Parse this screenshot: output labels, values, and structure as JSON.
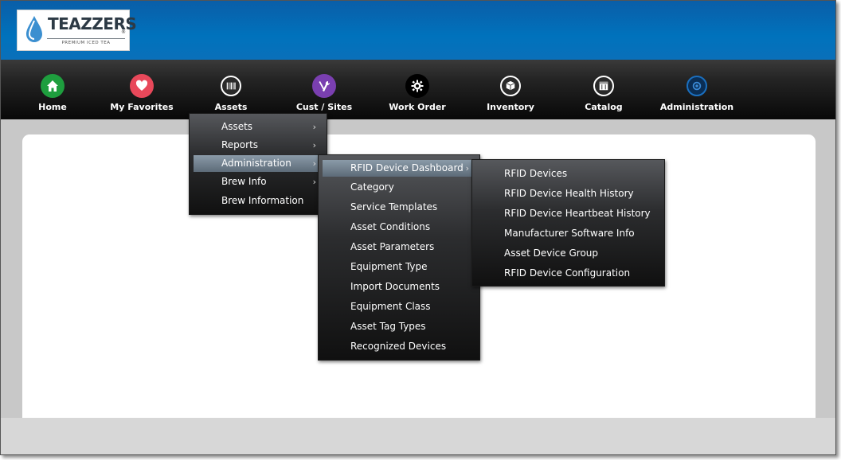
{
  "brand": {
    "name": "TEAZZERS",
    "tagline": "PREMIUM ICED TEA",
    "mark": "®"
  },
  "nav": [
    {
      "label": "Home",
      "icon": "home-icon",
      "color": "#1e9e3e"
    },
    {
      "label": "My Favorites",
      "icon": "heart-icon",
      "color": "#e8485a"
    },
    {
      "label": "Assets",
      "icon": "barcode-icon",
      "color": "#2a2a2a"
    },
    {
      "label": "Cust / Sites",
      "icon": "tools-icon",
      "color": "#7a3fb0"
    },
    {
      "label": "Work Order",
      "icon": "gear-icon",
      "color": "#000000"
    },
    {
      "label": "Inventory",
      "icon": "box-icon",
      "color": "#2a2a2a"
    },
    {
      "label": "Catalog",
      "icon": "catalog-icon",
      "color": "#2a2a2a"
    },
    {
      "label": "Administration",
      "icon": "target-icon",
      "color": "#0a2e55"
    }
  ],
  "menu1": [
    {
      "label": "Assets",
      "submenu": true
    },
    {
      "label": "Reports",
      "submenu": true
    },
    {
      "label": "Administration",
      "submenu": true,
      "active": true
    },
    {
      "label": "Brew Info",
      "submenu": true
    },
    {
      "label": "Brew Information",
      "submenu": false
    }
  ],
  "menu2": [
    {
      "label": "RFID Device Dashboard",
      "submenu": true,
      "active": true
    },
    {
      "label": "Category"
    },
    {
      "label": "Service Templates"
    },
    {
      "label": "Asset Conditions"
    },
    {
      "label": "Asset Parameters"
    },
    {
      "label": "Equipment Type"
    },
    {
      "label": "Import Documents"
    },
    {
      "label": "Equipment Class"
    },
    {
      "label": "Asset Tag Types"
    },
    {
      "label": "Recognized Devices"
    }
  ],
  "menu3": [
    {
      "label": "RFID Devices"
    },
    {
      "label": "RFID Device Health History"
    },
    {
      "label": "RFID Device Heartbeat History"
    },
    {
      "label": "Manufacturer Software Info"
    },
    {
      "label": "Asset Device Group"
    },
    {
      "label": "RFID Device Configuration"
    }
  ],
  "arrow_glyph": "›"
}
